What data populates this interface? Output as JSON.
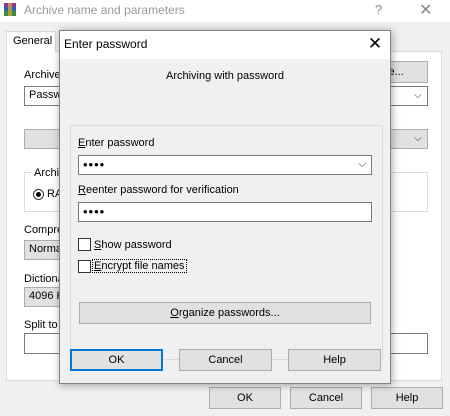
{
  "background_dialog": {
    "title": "Archive name and parameters",
    "help_glyph": "?",
    "close_glyph": "✕",
    "tab_general": "General",
    "label_archive": "Archive",
    "archive_field_value": "Passw",
    "browse_button": "se...",
    "label_archive_format": "Archiv",
    "radio_rar": "RA",
    "label_compression": "Compre",
    "compression_value": "Normal",
    "label_dictionary": "Dictiona",
    "dictionary_value": "4096 K",
    "label_split": "Split to",
    "ok_button": "OK",
    "cancel_button": "Cancel",
    "help_button": "Help"
  },
  "password_dialog": {
    "title": "Enter password",
    "close_glyph": "✕",
    "heading": "Archiving with password",
    "enter_password_label": "Enter password",
    "enter_password_value": "••••",
    "reenter_label": "Reenter password for verification",
    "reenter_value": "••••",
    "show_password_label": "Show password",
    "show_password_checked": false,
    "encrypt_names_label": "Encrypt file names",
    "encrypt_names_checked": false,
    "organize_button": "Organize passwords...",
    "ok_button": "OK",
    "cancel_button": "Cancel",
    "help_button": "Help"
  },
  "colors": {
    "focus_border": "#0078d7",
    "button_face": "#e1e1e1",
    "window_bg": "#f0f0f0"
  }
}
